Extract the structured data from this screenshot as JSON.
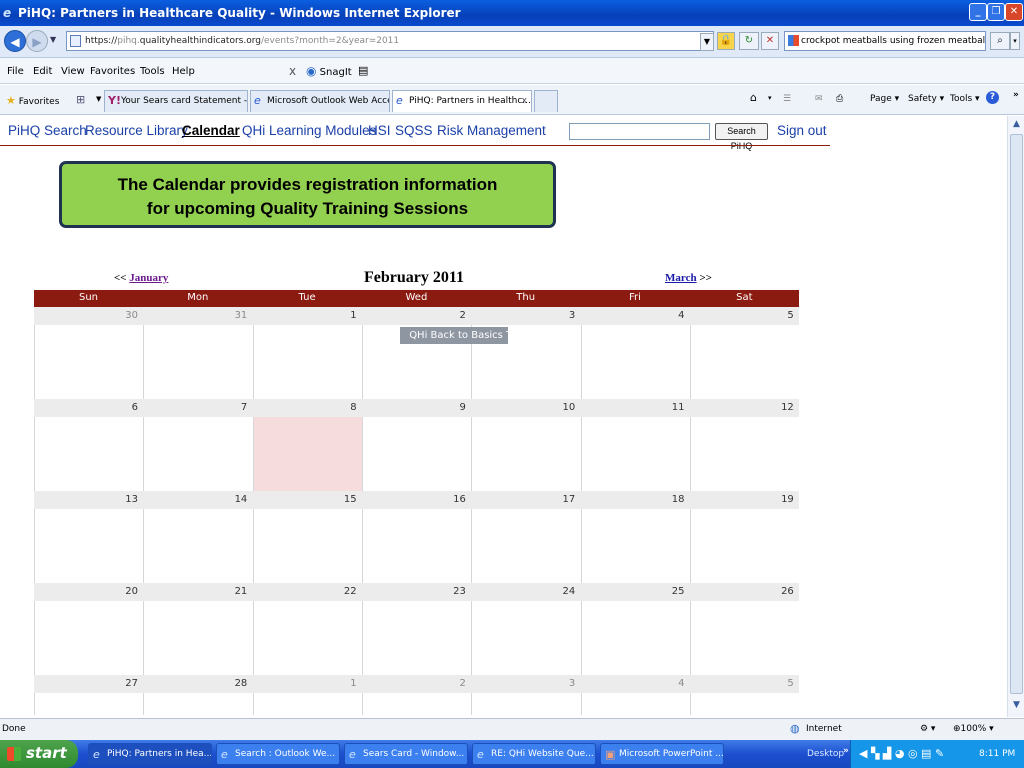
{
  "window": {
    "title": "PiHQ: Partners in Healthcare Quality - Windows Internet Explorer",
    "controls": [
      "_",
      "❐",
      "✕"
    ]
  },
  "address": {
    "url_prefix": "https://",
    "url_dim1": "pihq.",
    "url_domain": "qualityhealthindicators.org",
    "url_path": "/events?month=2&year=2011",
    "search_value": "crockpot meatballs using frozen meatballs"
  },
  "menu": {
    "items": [
      "File",
      "Edit",
      "View",
      "Favorites",
      "Tools",
      "Help"
    ],
    "close_x": "x",
    "snagit": "SnagIt"
  },
  "favbar": {
    "favorites": "Favorites",
    "tabs": [
      "Your Sears card Statement - ...",
      "Microsoft Outlook Web Access",
      "PiHQ: Partners in Healthc..."
    ],
    "page": "Page ▾",
    "safety": "Safety ▾",
    "tools": "Tools ▾"
  },
  "sitenav": {
    "links": [
      "PiHQ Search",
      "Resource Library",
      "Calendar",
      "QHi",
      "Learning Modules",
      "HSI",
      "SQSS",
      "Risk Management"
    ],
    "search_button": "Search PiHQ",
    "sign_out": "Sign out"
  },
  "callout": {
    "line1": "The Calendar provides registration information",
    "line2": "for upcoming Quality Training Sessions"
  },
  "calendar": {
    "prev_arrows": "<<",
    "prev_label": "January",
    "month_title": "February 2011",
    "next_label": "March",
    "next_arrows": ">>",
    "day_names": [
      "Sun",
      "Mon",
      "Tue",
      "Wed",
      "Thu",
      "Fri",
      "Sat"
    ],
    "weeks": [
      [
        "30",
        "31",
        "1",
        "2",
        "3",
        "4",
        "5"
      ],
      [
        "6",
        "7",
        "8",
        "9",
        "10",
        "11",
        "12"
      ],
      [
        "13",
        "14",
        "15",
        "16",
        "17",
        "18",
        "19"
      ],
      [
        "20",
        "21",
        "22",
        "23",
        "24",
        "25",
        "26"
      ],
      [
        "27",
        "28",
        "1",
        "2",
        "3",
        "4",
        "5"
      ]
    ],
    "event_label": "QHi Back to Basics Tr"
  },
  "status": {
    "left": "Done",
    "zone": "Internet",
    "zoom": "100%"
  },
  "taskbar": {
    "start": "start",
    "tasks": [
      "PiHQ: Partners in Hea...",
      "Search : Outlook We...",
      "Sears Card - Window...",
      "RE: QHi Website Que...",
      "Microsoft PowerPoint ..."
    ],
    "desktop": "Desktop",
    "clock": "8:11 PM"
  }
}
